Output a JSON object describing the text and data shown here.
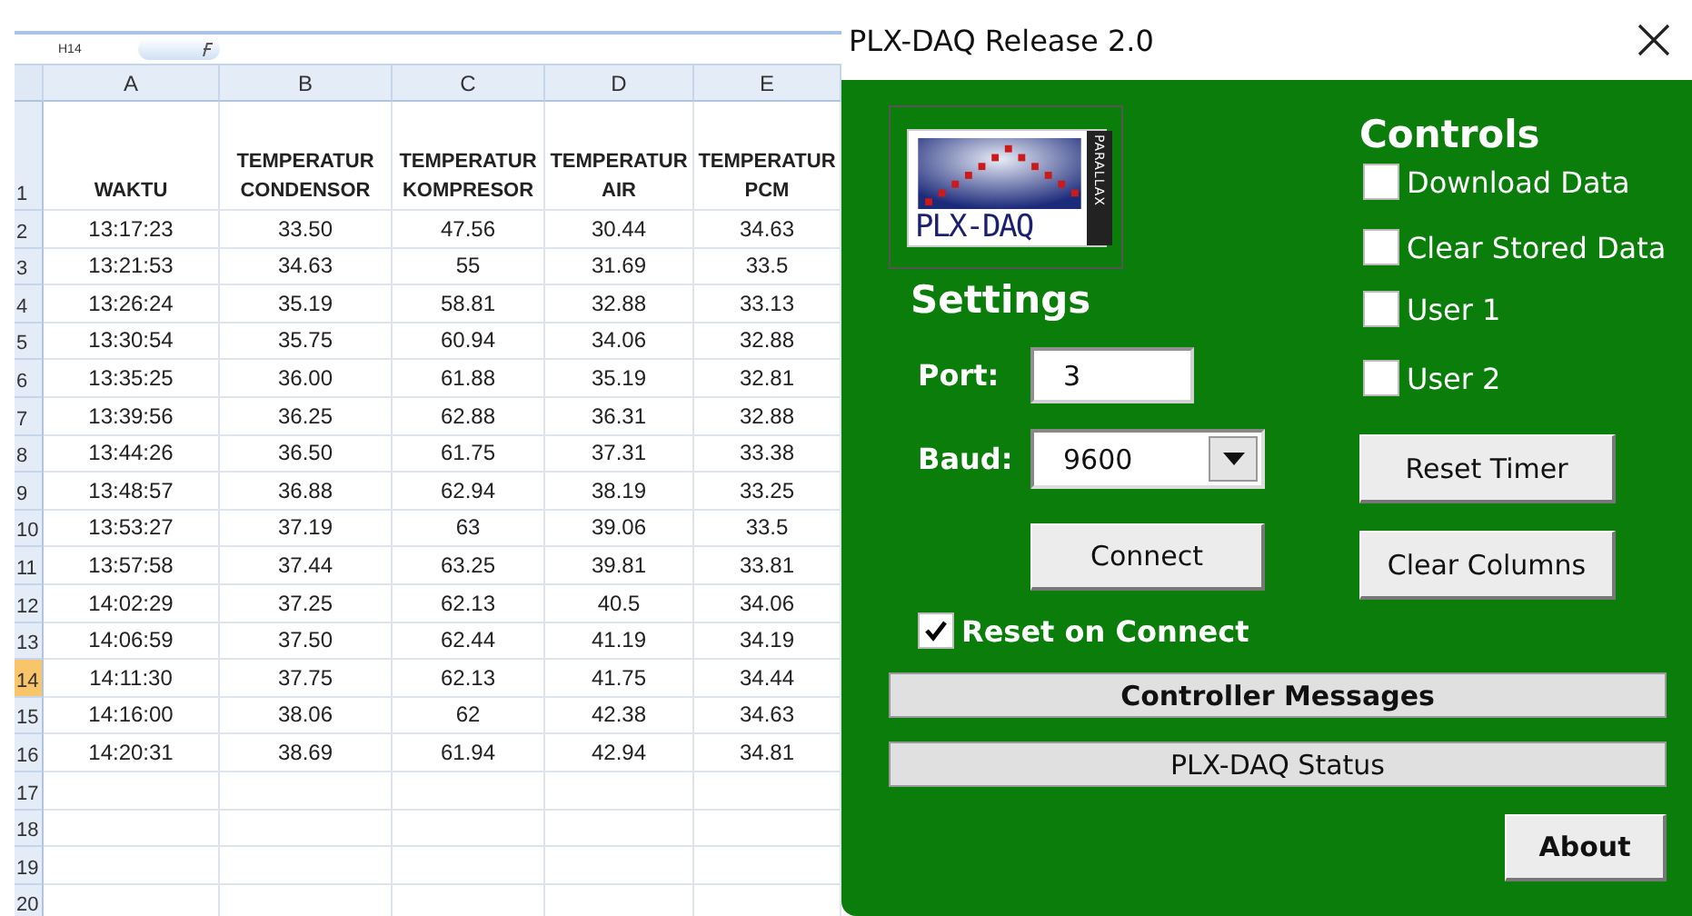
{
  "spreadsheet": {
    "name_box": "H14",
    "columns": [
      {
        "label": "A"
      },
      {
        "label": "B"
      },
      {
        "label": "C"
      },
      {
        "label": "D"
      },
      {
        "label": "E"
      }
    ],
    "rows": [
      {
        "number": "1",
        "selected": false,
        "cells": [
          "WAKTU",
          "TEMPERATUR CONDENSOR",
          "TEMPERATUR KOMPRESOR",
          "TEMPERATUR AIR",
          "TEMPERATUR PCM"
        ]
      },
      {
        "number": "2",
        "selected": false,
        "cells": [
          "13:17:23",
          "33.50",
          "47.56",
          "30.44",
          "34.63"
        ]
      },
      {
        "number": "3",
        "selected": false,
        "cells": [
          "13:21:53",
          "34.63",
          "55",
          "31.69",
          "33.5"
        ]
      },
      {
        "number": "4",
        "selected": false,
        "cells": [
          "13:26:24",
          "35.19",
          "58.81",
          "32.88",
          "33.13"
        ]
      },
      {
        "number": "5",
        "selected": false,
        "cells": [
          "13:30:54",
          "35.75",
          "60.94",
          "34.06",
          "32.88"
        ]
      },
      {
        "number": "6",
        "selected": false,
        "cells": [
          "13:35:25",
          "36.00",
          "61.88",
          "35.19",
          "32.81"
        ]
      },
      {
        "number": "7",
        "selected": false,
        "cells": [
          "13:39:56",
          "36.25",
          "62.88",
          "36.31",
          "32.88"
        ]
      },
      {
        "number": "8",
        "selected": false,
        "cells": [
          "13:44:26",
          "36.50",
          "61.75",
          "37.31",
          "33.38"
        ]
      },
      {
        "number": "9",
        "selected": false,
        "cells": [
          "13:48:57",
          "36.88",
          "62.94",
          "38.19",
          "33.25"
        ]
      },
      {
        "number": "10",
        "selected": false,
        "cells": [
          "13:53:27",
          "37.19",
          "63",
          "39.06",
          "33.5"
        ]
      },
      {
        "number": "11",
        "selected": false,
        "cells": [
          "13:57:58",
          "37.44",
          "63.25",
          "39.81",
          "33.81"
        ]
      },
      {
        "number": "12",
        "selected": false,
        "cells": [
          "14:02:29",
          "37.25",
          "62.13",
          "40.5",
          "34.06"
        ]
      },
      {
        "number": "13",
        "selected": false,
        "cells": [
          "14:06:59",
          "37.50",
          "62.44",
          "41.19",
          "34.19"
        ]
      },
      {
        "number": "14",
        "selected": true,
        "cells": [
          "14:11:30",
          "37.75",
          "62.13",
          "41.75",
          "34.44"
        ]
      },
      {
        "number": "15",
        "selected": false,
        "cells": [
          "14:16:00",
          "38.06",
          "62",
          "42.38",
          "34.63"
        ]
      },
      {
        "number": "16",
        "selected": false,
        "cells": [
          "14:20:31",
          "38.69",
          "61.94",
          "42.94",
          "34.81"
        ]
      },
      {
        "number": "17",
        "selected": false,
        "cells": []
      },
      {
        "number": "18",
        "selected": false,
        "cells": []
      },
      {
        "number": "19",
        "selected": false,
        "cells": []
      },
      {
        "number": "20",
        "selected": false,
        "cells": []
      }
    ]
  },
  "dialog": {
    "title": "PLX-DAQ Release 2.0",
    "logo": {
      "text": "PLX-DAQ",
      "side_text": "PARALLAX"
    },
    "settings": {
      "heading": "Settings",
      "port": {
        "label": "Port:",
        "value": "3"
      },
      "baud": {
        "label": "Baud:",
        "value": "9600"
      },
      "connect_button": "Connect",
      "reset_on_connect": {
        "label": "Reset on Connect",
        "checked": true
      }
    },
    "controls": {
      "heading": "Controls",
      "checkboxes": [
        {
          "label": "Download Data",
          "checked": false
        },
        {
          "label": "Clear Stored Data",
          "checked": false
        },
        {
          "label": "User 1",
          "checked": false
        },
        {
          "label": "User 2",
          "checked": false
        }
      ],
      "buttons": [
        "Reset Timer",
        "Clear Columns"
      ]
    },
    "controller_messages": "Controller Messages",
    "status": "PLX-DAQ Status",
    "about_button": "About"
  }
}
